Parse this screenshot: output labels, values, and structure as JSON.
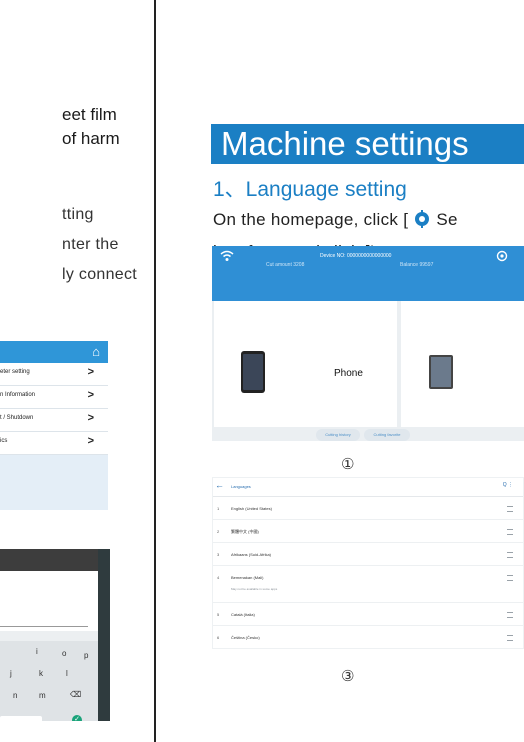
{
  "left_column": {
    "text_lines": [
      "eet film",
      "of harm",
      "tting",
      "nter the",
      "ly connect"
    ],
    "menu_screenshot": {
      "items": [
        {
          "label": "eter setting",
          "chevron": ">"
        },
        {
          "label": "n Information",
          "chevron": ">"
        },
        {
          "label": "t / Shutdown",
          "chevron": ">"
        },
        {
          "label": "ics",
          "chevron": ">"
        }
      ]
    },
    "keyboard_screenshot": {
      "keys_row1": [
        "i",
        "o",
        "p"
      ],
      "keys_row2": [
        "j",
        "k",
        "l"
      ],
      "keys_row3": [
        "n",
        "m"
      ]
    }
  },
  "right_column": {
    "section_title": "Machine settings",
    "subsection_title": "1、Language setting",
    "instruction_line1_start": "On the homepage, click [ ",
    "instruction_line1_end": "Se",
    "instruction_line2": "interface, and click [Language",
    "home_screenshot": {
      "device_no": "Device NO: 0000000000000000",
      "cut_amount": "Cut amount   3208",
      "balance": "Balance   99597",
      "card_label": "Phone",
      "pills": [
        "Cutting history",
        "Cutting favorite"
      ]
    },
    "marker_1": "①",
    "language_screenshot": {
      "header_title": "Languages",
      "header_actions": "Q  ⋮",
      "rows": [
        {
          "num": "1",
          "name": "English (United States)",
          "note": ""
        },
        {
          "num": "2",
          "name": "繁體中文 (中國)",
          "note": ""
        },
        {
          "num": "3",
          "name": "Afrikaans (Suid-Afrika)",
          "note": ""
        },
        {
          "num": "4",
          "name": "Bemenakan (Mali)",
          "note": "May not be available in some apps"
        },
        {
          "num": "5",
          "name": "Català (Italia)",
          "note": ""
        },
        {
          "num": "6",
          "name": "Čeština (Česko)",
          "note": ""
        }
      ]
    },
    "marker_3": "③"
  },
  "colors": {
    "accent_blue": "#1b7fc4",
    "app_bar_blue": "#2f8fd5",
    "divider": "#222222"
  }
}
